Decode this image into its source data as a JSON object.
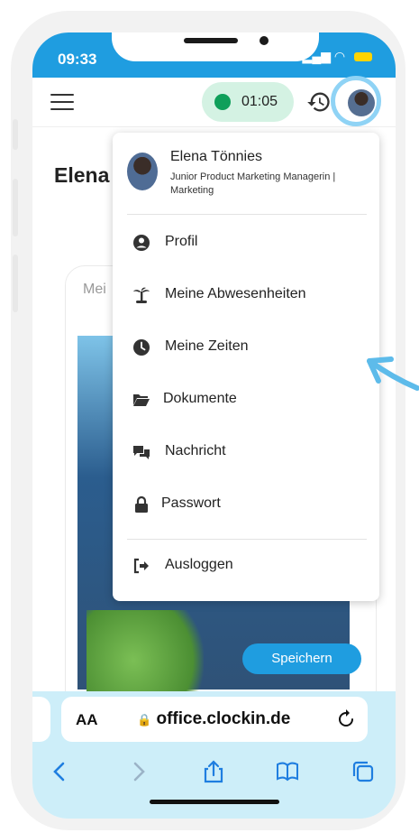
{
  "status": {
    "time": "09:33"
  },
  "appbar": {
    "timer": "01:05"
  },
  "page": {
    "title": "Elena",
    "subtitle": "Mei"
  },
  "profile": {
    "name": "Elena Tönnies",
    "role": "Junior Product Marketing Managerin | Marketing"
  },
  "menu": {
    "items": [
      {
        "label": "Profil",
        "icon": "user-circle-icon"
      },
      {
        "label": "Meine Abwesenheiten",
        "icon": "palm-tree-icon"
      },
      {
        "label": "Meine Zeiten",
        "icon": "clock-icon"
      },
      {
        "label": "Dokumente",
        "icon": "folder-open-icon"
      },
      {
        "label": "Nachricht",
        "icon": "chat-bubbles-icon"
      },
      {
        "label": "Passwort",
        "icon": "lock-icon"
      }
    ],
    "logout": {
      "label": "Ausloggen",
      "icon": "sign-out-icon"
    }
  },
  "content": {
    "save_label": "Speichern"
  },
  "safari": {
    "aa": "AA",
    "url": "office.clockin.de"
  },
  "colors": {
    "accent": "#1f9de0",
    "timer_bg": "#d4f2e3",
    "timer_dot": "#0f9f5a",
    "safari_bg": "#cdeef9",
    "highlight": "#8fd3f5"
  }
}
